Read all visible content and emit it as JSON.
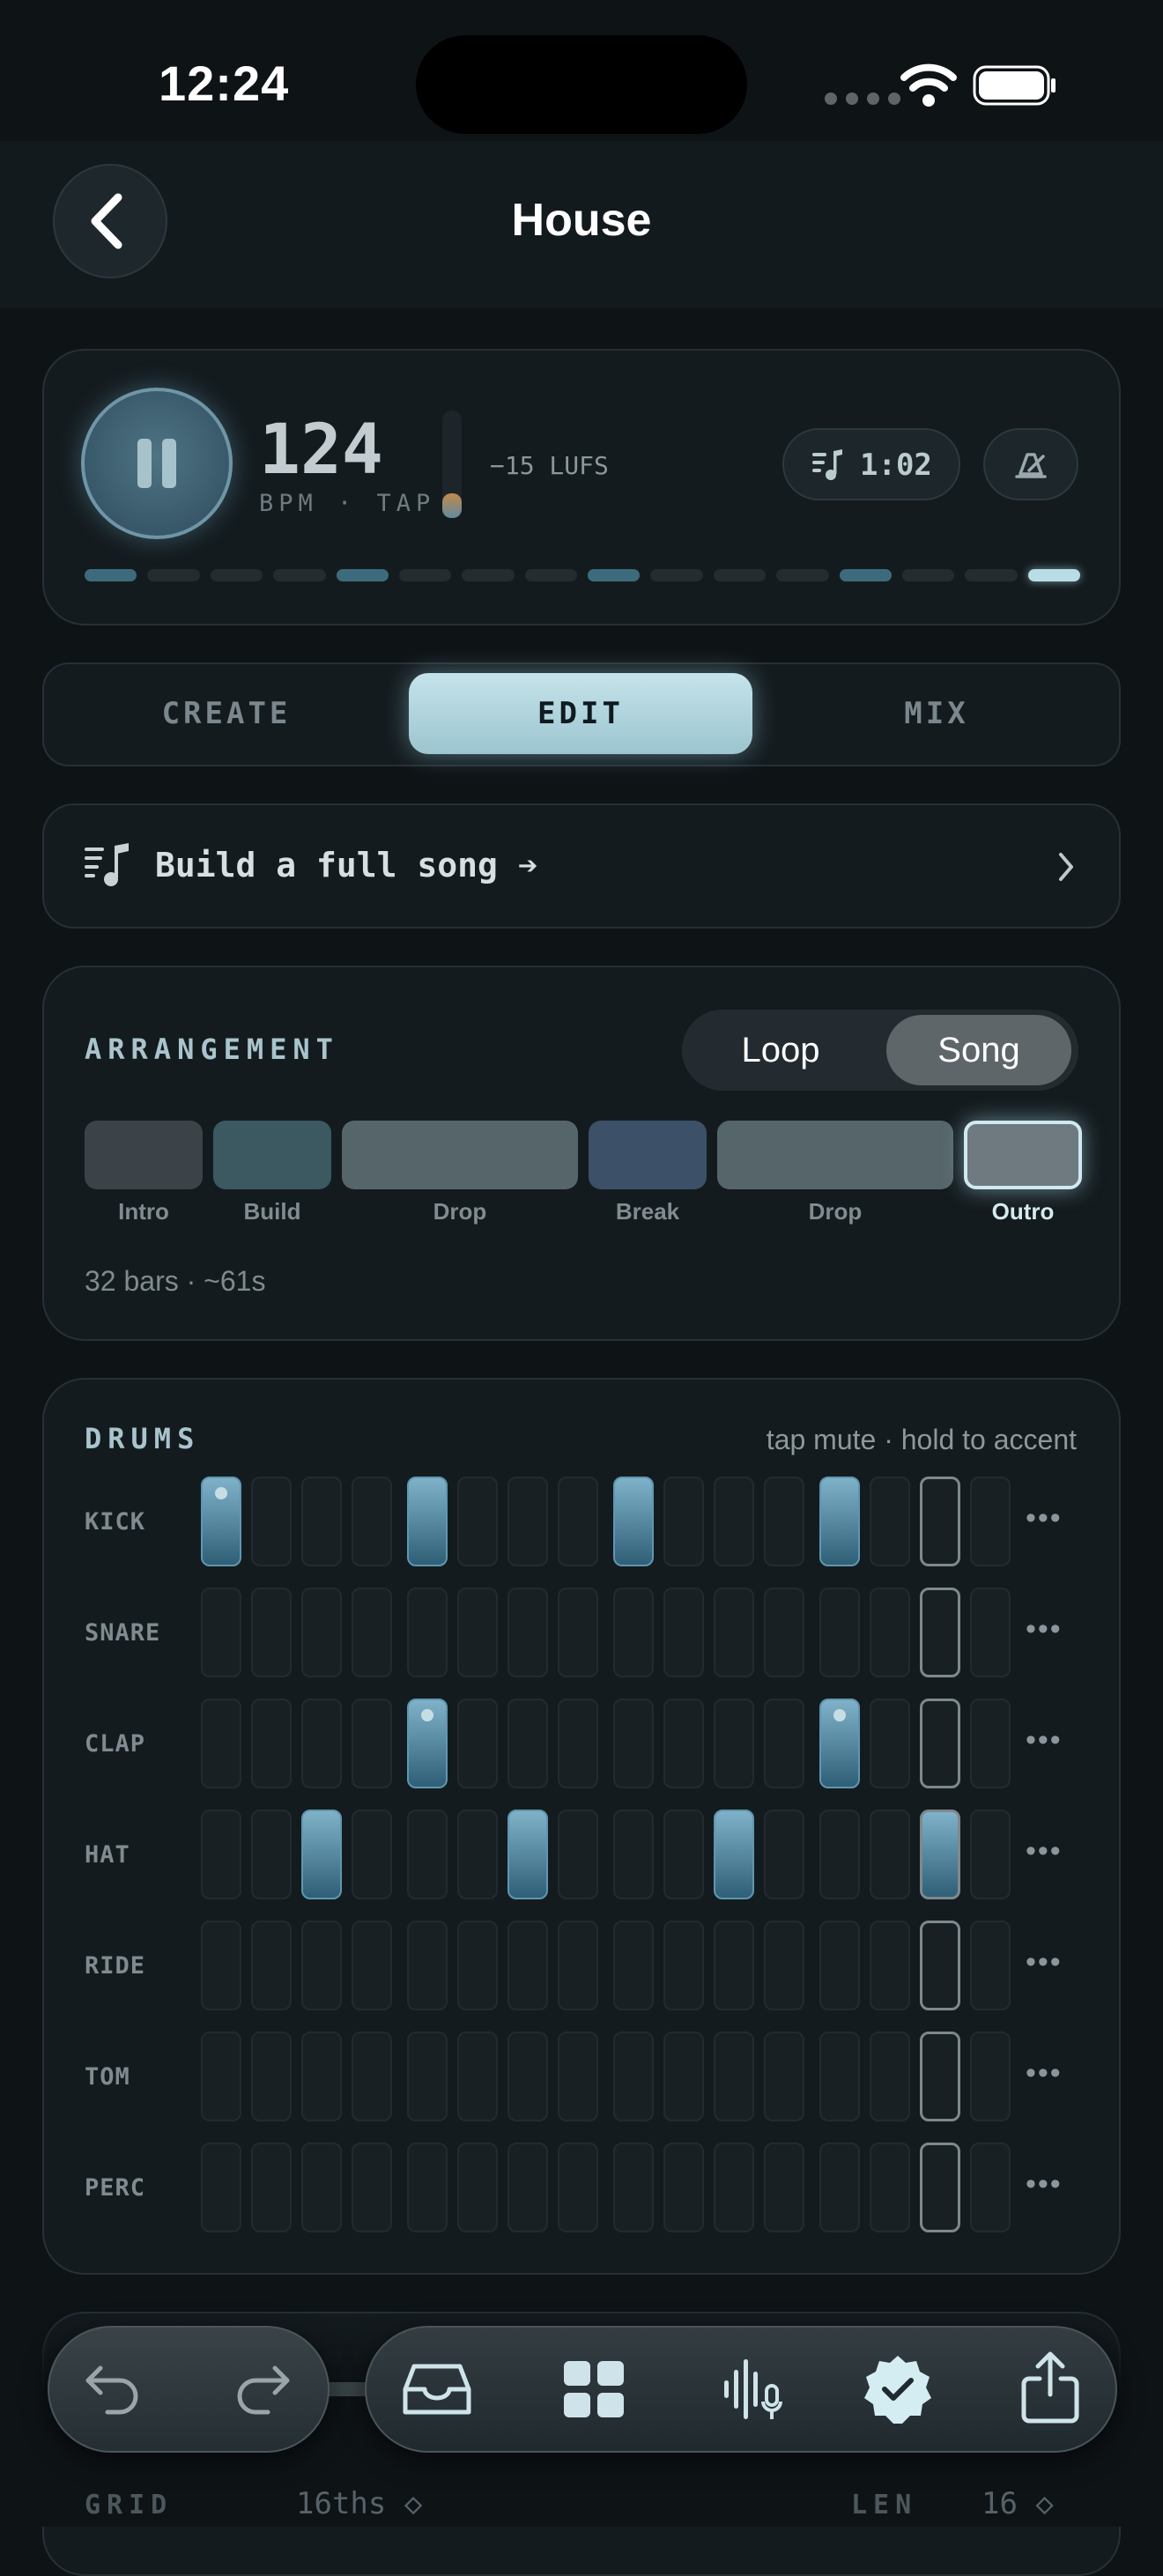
{
  "status": {
    "time": "12:24"
  },
  "header": {
    "title": "House"
  },
  "transport": {
    "bpm": "124",
    "bpm_label": "BPM · TAP",
    "loudness": "−15 LUFS",
    "length": "1:02",
    "progress_steps": 16,
    "progress_lit": [
      0,
      4,
      8,
      12
    ],
    "progress_current": 15
  },
  "tabs": [
    "CREATE",
    "EDIT",
    "MIX"
  ],
  "active_tab": "EDIT",
  "cta": {
    "label": "Build a full song ➔"
  },
  "arrangement": {
    "title": "ARRANGEMENT",
    "mode_options": [
      "Loop",
      "Song"
    ],
    "mode_selected": "Song",
    "sections": [
      {
        "name": "Intro",
        "color": "#3b4348"
      },
      {
        "name": "Build",
        "color": "#3c5861"
      },
      {
        "name": "Drop",
        "color": "#56656a"
      },
      {
        "name": "Break",
        "color": "#3c5068"
      },
      {
        "name": "Drop",
        "color": "#56656a"
      },
      {
        "name": "Outro",
        "color": "#6e7a80",
        "selected": true
      }
    ],
    "summary": "32 bars · ~61s"
  },
  "drums": {
    "title": "DRUMS",
    "hint": "tap mute · hold to accent",
    "more_label": "•••",
    "playhead_step": 14,
    "rows": [
      {
        "name": "KICK",
        "active": [
          0,
          4,
          8,
          12
        ],
        "accent": [
          0
        ]
      },
      {
        "name": "SNARE",
        "active": [],
        "accent": []
      },
      {
        "name": "CLAP",
        "active": [
          4,
          12
        ],
        "accent": [
          4,
          12
        ]
      },
      {
        "name": "HAT",
        "active": [
          2,
          6,
          10,
          14
        ],
        "accent": []
      },
      {
        "name": "RIDE",
        "active": [],
        "accent": []
      },
      {
        "name": "TOM",
        "active": [],
        "accent": []
      },
      {
        "name": "PERC",
        "active": [],
        "accent": []
      }
    ]
  },
  "footer_settings": {
    "grid_label": "GRID",
    "grid_value": "16ths ◇",
    "len_label": "LEN",
    "len_value": "16 ◇"
  },
  "toolbar": {
    "icons": [
      "undo-icon",
      "redo-icon",
      "inbox-icon",
      "grid-icon",
      "voice-icon",
      "verified-icon",
      "share-icon"
    ]
  },
  "colors": {
    "accent": "#b9dde6",
    "step_active": "#4f8aa4",
    "background": "#0e1316"
  }
}
